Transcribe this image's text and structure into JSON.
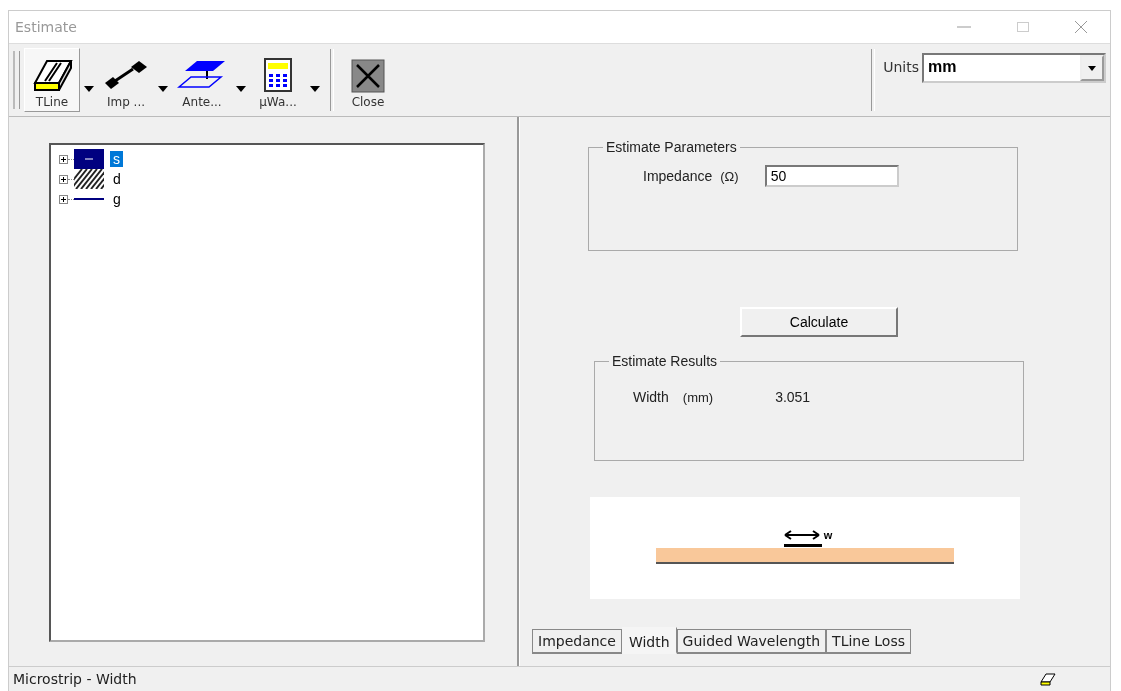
{
  "window": {
    "title": "Estimate"
  },
  "toolbar": [
    {
      "label": "TLine",
      "kind": "tline",
      "selected": true,
      "has_menu": true
    },
    {
      "label": "Imp ...",
      "kind": "imp",
      "selected": false,
      "has_menu": true
    },
    {
      "label": "Ante...",
      "kind": "antenna",
      "selected": false,
      "has_menu": true
    },
    {
      "label": "µWa...",
      "kind": "calc",
      "selected": false,
      "has_menu": true
    },
    {
      "label": "Close",
      "kind": "close",
      "selected": false,
      "has_menu": false
    }
  ],
  "units": {
    "label": "Units",
    "value": "mm"
  },
  "tree": [
    {
      "label": "s",
      "kind": "solid",
      "selected": true
    },
    {
      "label": "d",
      "kind": "hatched",
      "selected": false
    },
    {
      "label": "g",
      "kind": "line",
      "selected": false
    }
  ],
  "parameters": {
    "title": "Estimate Parameters",
    "label": "Impedance",
    "unit": "(Ω)",
    "value": "50"
  },
  "calculate_button": "Calculate",
  "results": {
    "title": "Estimate Results",
    "label": "Width",
    "unit": "(mm)",
    "value": "3.051"
  },
  "diagram": {
    "label": "w"
  },
  "tabs": [
    {
      "label": "Impedance",
      "selected": false
    },
    {
      "label": "Width",
      "selected": true
    },
    {
      "label": "Guided Wavelength",
      "selected": false
    },
    {
      "label": "TLine Loss",
      "selected": false
    }
  ],
  "status_bar": {
    "text": "Microstrip - Width"
  }
}
